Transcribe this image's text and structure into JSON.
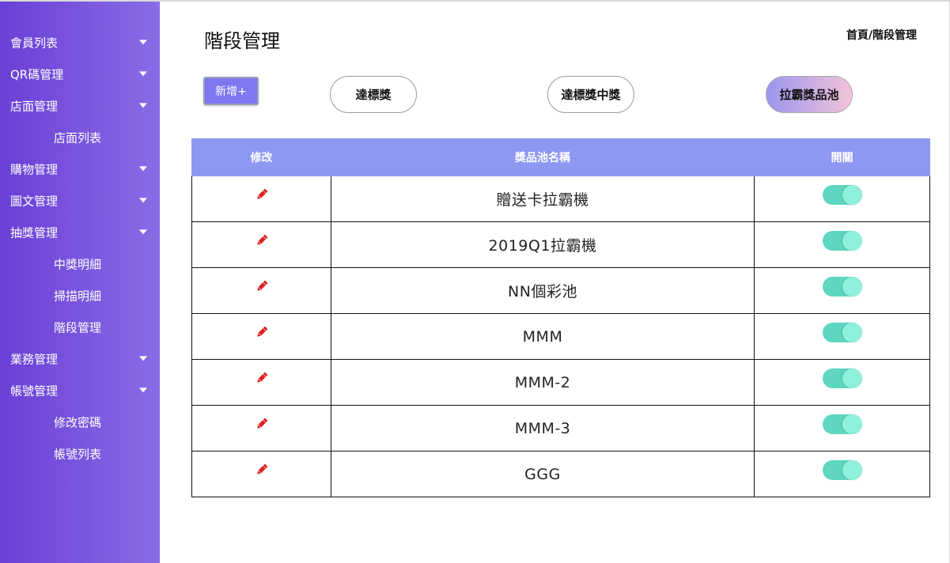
{
  "sidebar": {
    "items": [
      {
        "label": "會員列表",
        "expandable": true
      },
      {
        "label": "QR碼管理",
        "expandable": true
      },
      {
        "label": "店面管理",
        "expandable": true
      },
      {
        "label": "店面列表",
        "expandable": false,
        "sub": true
      },
      {
        "label": "購物管理",
        "expandable": true
      },
      {
        "label": "圖文管理",
        "expandable": true
      },
      {
        "label": "抽獎管理",
        "expandable": true
      },
      {
        "label": "中獎明細",
        "expandable": false,
        "sub": true
      },
      {
        "label": "掃描明細",
        "expandable": false,
        "sub": true
      },
      {
        "label": "階段管理",
        "expandable": false,
        "sub": true
      },
      {
        "label": "業務管理",
        "expandable": true
      },
      {
        "label": "帳號管理",
        "expandable": true
      },
      {
        "label": "修改密碼",
        "expandable": false,
        "sub": true
      },
      {
        "label": "帳號列表",
        "expandable": false,
        "sub": true
      }
    ]
  },
  "header": {
    "title": "階段管理",
    "breadcrumb": "首頁/階段管理"
  },
  "toolbar": {
    "add_label": "新增+",
    "tabs": [
      {
        "label": "達標獎",
        "active": false
      },
      {
        "label": "達標獎中獎",
        "active": false
      },
      {
        "label": "拉霸獎品池",
        "active": true
      }
    ]
  },
  "table": {
    "columns": [
      "修改",
      "獎品池名稱",
      "開關"
    ],
    "rows": [
      {
        "name": "贈送卡拉霸機",
        "enabled": true
      },
      {
        "name": "2019Q1拉霸機",
        "enabled": true
      },
      {
        "name": "NN個彩池",
        "enabled": true
      },
      {
        "name": "MMM",
        "enabled": true
      },
      {
        "name": "MMM-2",
        "enabled": true
      },
      {
        "name": "MMM-3",
        "enabled": true
      },
      {
        "name": "GGG",
        "enabled": true
      }
    ]
  },
  "icons": {
    "edit": "pencil-icon",
    "expand": "caret-down-icon",
    "switch": "toggle-switch"
  },
  "colors": {
    "sidebar_gradient_start": "#6a3fd6",
    "sidebar_gradient_end": "#8a6ce6",
    "table_header": "#8e98f3",
    "add_button": "#7d77f0",
    "toggle_on": "#5ed6c0",
    "pencil": "#e02020"
  }
}
